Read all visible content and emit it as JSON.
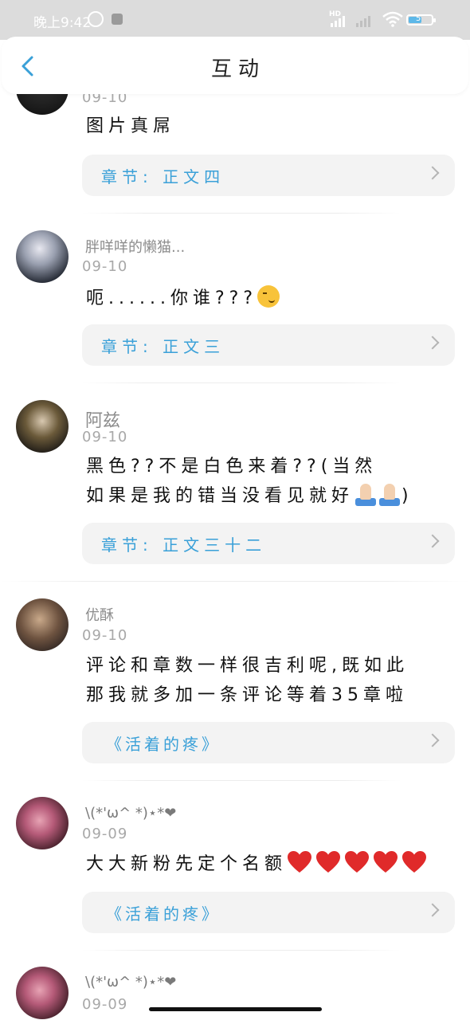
{
  "status_bar": {
    "time": "晚上9:42",
    "hd_label": "HD",
    "battery_level": "5",
    "icons": [
      "alarm-icon",
      "app-notification-icon",
      "signal-icon",
      "signal-2-icon",
      "wifi-icon",
      "battery-icon"
    ]
  },
  "header": {
    "title": "互动",
    "back_icon": "chevron-left-icon"
  },
  "colors": {
    "accent": "#3aa0d8",
    "status_bar_bg": "#dcdcdc",
    "chapter_bg": "#f3f3f3",
    "username": "#8c8c8c",
    "date": "#a8a8a8",
    "text": "#111111"
  },
  "comments": [
    {
      "username": "",
      "date": "09-10",
      "content": "图片真屌",
      "chapter": "章节: 正文四"
    },
    {
      "username": "胖咩咩的懒猫...",
      "date": "09-10",
      "content": "呃......你谁???",
      "content_emoji": "smirk-emoji",
      "chapter": "章节: 正文三"
    },
    {
      "username": "阿兹",
      "date": "09-10",
      "content_line1": "黑色??不是白色来着??(当然",
      "content_line2": "如果是我的错当没看见就好",
      "content_line2_end": ")",
      "content_emoji": "folded-hands-emoji",
      "chapter": "章节: 正文三十二"
    },
    {
      "username": "优酥",
      "date": "09-10",
      "content_line1": "评论和章数一样很吉利呢,既如此",
      "content_line2": "那我就多加一条评论等着35章啦",
      "chapter": "《活着的疼》"
    },
    {
      "username": "\\(*'ω^ *)⋆*❤",
      "date": "09-09",
      "content": "大大新粉先定个名额",
      "content_emoji": "red-heart-emoji",
      "chapter": "《活着的疼》"
    },
    {
      "username": "\\(*'ω^ *)⋆*❤",
      "date": "09-09"
    }
  ]
}
